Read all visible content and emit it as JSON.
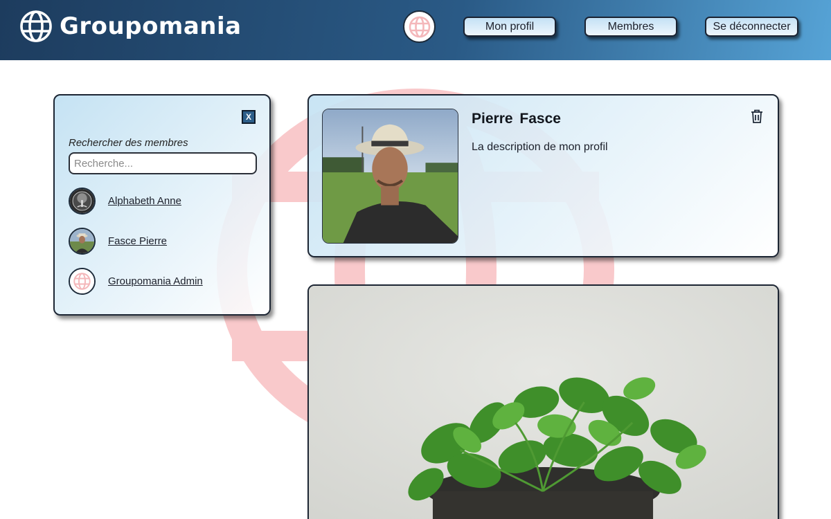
{
  "header": {
    "brand_name": "Groupomania",
    "nav": {
      "profile_label": "Mon profil",
      "members_label": "Membres",
      "logout_label": "Se déconnecter"
    }
  },
  "members_panel": {
    "close_label": "X",
    "search_label": "Rechercher des membres",
    "search_placeholder": "Recherche...",
    "members": [
      {
        "name": "Alphabeth Anne",
        "avatar": "tree-avatar"
      },
      {
        "name": "Fasce Pierre",
        "avatar": "photo-avatar"
      },
      {
        "name": "Groupomania Admin",
        "avatar": "globe-avatar"
      }
    ]
  },
  "profile": {
    "first_name": "Pierre",
    "last_name": "Fasce",
    "full_name": "Pierre  Fasce",
    "description": "La description de mon profil"
  },
  "icons": {
    "brand": "globe-icon",
    "delete": "trash-icon",
    "close": "close-icon"
  },
  "colors": {
    "header_start": "#1d3c5e",
    "header_end": "#56a3d6",
    "watermark": "#f7c4c6",
    "card_border": "#1c2533",
    "card_tint": "#c4e2f3"
  }
}
